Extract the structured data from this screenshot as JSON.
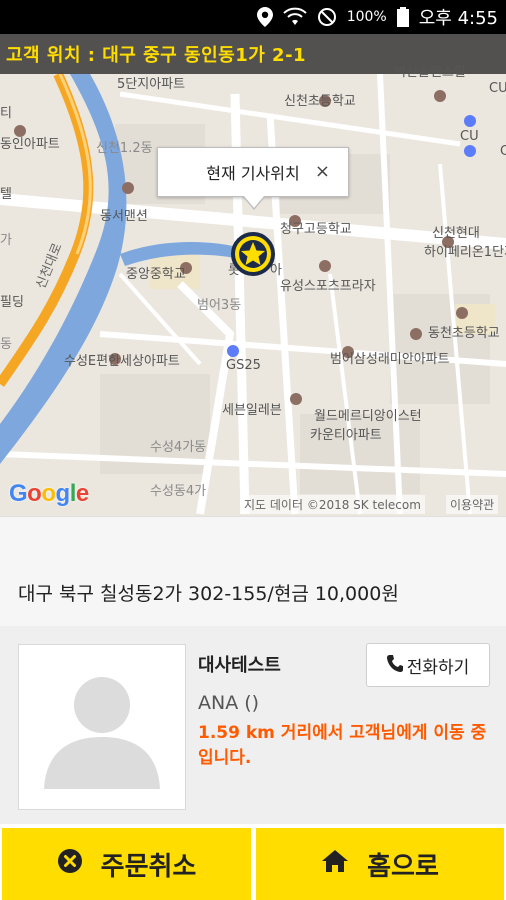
{
  "status_bar": {
    "battery_percent": "100%",
    "time": "오후 4:55",
    "icons": [
      "location-icon",
      "wifi-icon",
      "do-not-disturb-icon",
      "battery-icon"
    ]
  },
  "map": {
    "customer_location": "고객 위치 : 대구 중구 동인동1가 2-1",
    "callout_title": "현재 기사위치",
    "callout_close": "×",
    "labels": {
      "l1": "5단지아파트",
      "l2": "벽산솔렌스힐",
      "l3": "신천초등학교",
      "l4": "동인아파트",
      "l5": "신천1.2동",
      "l6": "동서맨션",
      "l7": "청구고등학교",
      "l8": "신천현대",
      "l9": "하이페리온1단지",
      "l10": "중앙중학교",
      "l11": "유성스포츠프라자",
      "l12": "범어3동",
      "l13": "동천초등학교",
      "l14": "수성E편한세상아파트",
      "l15": "범어삼성래미안아파트",
      "l16": "GS25",
      "l17": "세븐일레븐",
      "l18": "월드메르디앙이스턴",
      "l19": "카운티아파트",
      "l20": "수성4가동",
      "l21": "수성동4가",
      "l22": "신천대로",
      "l23": "CU",
      "l24": "CU",
      "l25": "CU",
      "l26": "티",
      "l27": "텔",
      "l28": "가",
      "l29": "동",
      "l30": "필딩",
      "l31": "롯",
      "l32": "아"
    },
    "google_logo": [
      "G",
      "o",
      "o",
      "g",
      "l",
      "e"
    ],
    "attribution": "지도 데이터 ©2018 SK telecom",
    "terms": "이용약관"
  },
  "order": {
    "address_payment": "대구 북구 칠성동2가 302-155/현금 10,000원"
  },
  "driver": {
    "name": "대사테스트",
    "car": "ANA ()",
    "status_message": "1.59 km 거리에서 고객님에게 이동 중입니다.",
    "call_label": "전화하기"
  },
  "actions": {
    "cancel_label": "주문취소",
    "home_label": "홈으로"
  },
  "colors": {
    "accent_yellow": "#ffdd00",
    "status_orange": "#ff5a00",
    "river_blue": "#7ea7dd",
    "highway_orange": "#f5a623"
  }
}
